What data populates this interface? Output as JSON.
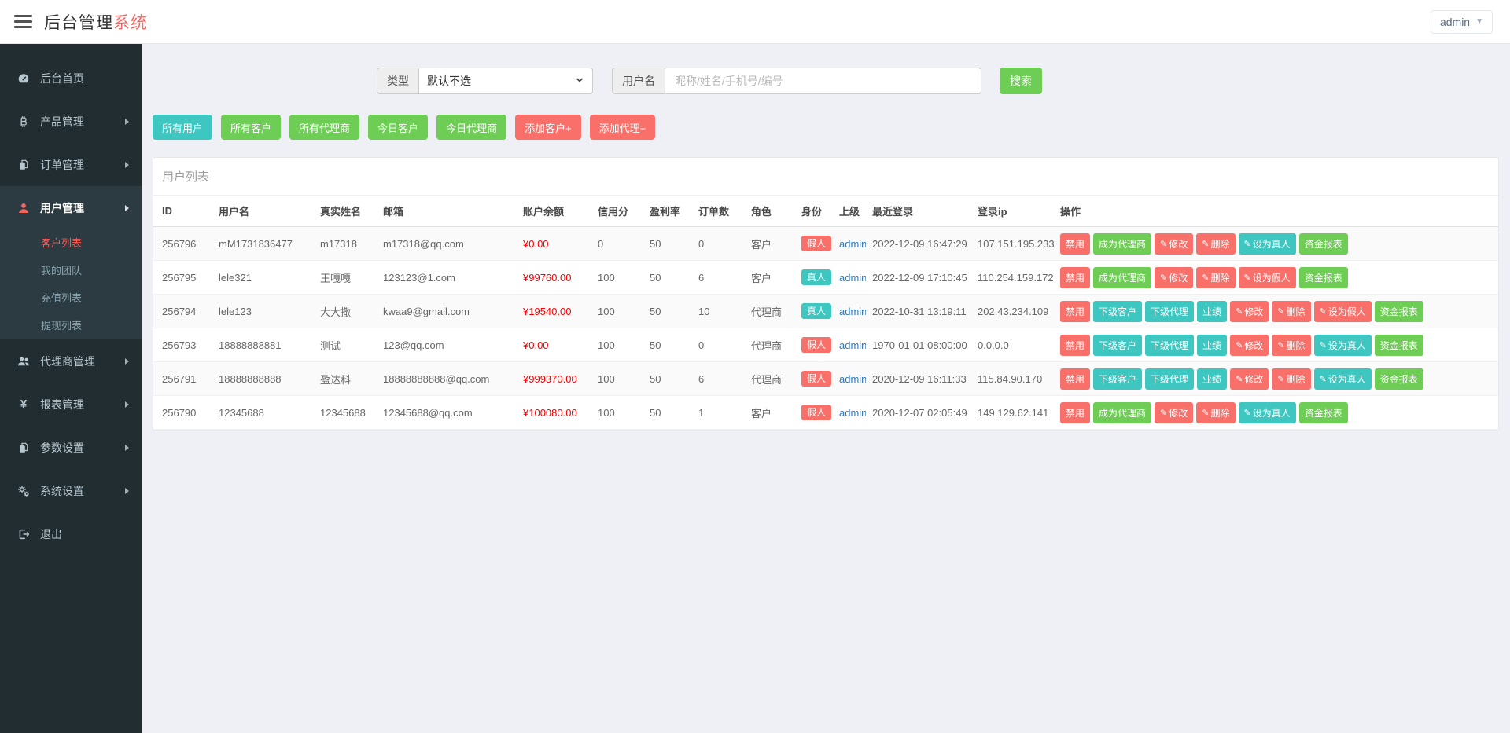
{
  "header": {
    "title_dark": "后台管理",
    "title_red": "系统",
    "user_menu": "admin"
  },
  "sidebar": {
    "items": [
      {
        "key": "home",
        "label": "后台首页",
        "icon": "dashboard-icon",
        "arrow": false,
        "active": false
      },
      {
        "key": "products",
        "label": "产品管理",
        "icon": "bitcoin-icon",
        "arrow": true,
        "active": false
      },
      {
        "key": "orders",
        "label": "订单管理",
        "icon": "orders-icon",
        "arrow": true,
        "active": false
      },
      {
        "key": "users",
        "label": "用户管理",
        "icon": "user-icon",
        "arrow": true,
        "active": true,
        "submenu": [
          {
            "key": "customers",
            "label": "客户列表",
            "active": true
          },
          {
            "key": "team",
            "label": "我的团队",
            "active": false
          },
          {
            "key": "recharge",
            "label": "充值列表",
            "active": false
          },
          {
            "key": "withdraw",
            "label": "提现列表",
            "active": false
          }
        ]
      },
      {
        "key": "agents",
        "label": "代理商管理",
        "icon": "agents-icon",
        "arrow": true,
        "active": false
      },
      {
        "key": "reports",
        "label": "报表管理",
        "icon": "yen-icon",
        "arrow": true,
        "active": false
      },
      {
        "key": "params",
        "label": "参数设置",
        "icon": "params-icon",
        "arrow": true,
        "active": false
      },
      {
        "key": "system",
        "label": "系统设置",
        "icon": "gears-icon",
        "arrow": true,
        "active": false
      },
      {
        "key": "logout",
        "label": "退出",
        "icon": "logout-icon",
        "arrow": false,
        "active": false
      }
    ]
  },
  "filters": {
    "type_label": "类型",
    "type_value": "默认不选",
    "username_label": "用户名",
    "username_placeholder": "昵称/姓名/手机号/编号",
    "search_button": "搜索"
  },
  "toolbar": {
    "buttons": [
      {
        "label": "所有用户",
        "color": "teal"
      },
      {
        "label": "所有客户",
        "color": "green"
      },
      {
        "label": "所有代理商",
        "color": "green"
      },
      {
        "label": "今日客户",
        "color": "green"
      },
      {
        "label": "今日代理商",
        "color": "green"
      },
      {
        "label": "添加客户+",
        "color": "red"
      },
      {
        "label": "添加代理+",
        "color": "red"
      }
    ]
  },
  "table": {
    "title": "用户列表",
    "columns": [
      "ID",
      "用户名",
      "真实姓名",
      "邮箱",
      "账户余额",
      "信用分",
      "盈利率",
      "订单数",
      "角色",
      "身份",
      "上级",
      "最近登录",
      "登录ip",
      "操作"
    ],
    "rows": [
      {
        "id": "256796",
        "username": "mM1731836477",
        "realname": "m17318",
        "email": "m17318@qq.com",
        "balance": "¥0.00",
        "credit": "0",
        "profit_rate": "50",
        "order_count": "0",
        "role": "客户",
        "identity": "假人",
        "identity_color": "red",
        "parent": "admin",
        "last_login": "2022-12-09 16:47:29",
        "login_ip": "107.151.195.233",
        "actions": [
          {
            "label": "禁用",
            "color": "red",
            "pencil": false
          },
          {
            "label": "成为代理商",
            "color": "green",
            "pencil": false
          },
          {
            "label": "修改",
            "color": "red",
            "pencil": true
          },
          {
            "label": "删除",
            "color": "red",
            "pencil": true
          },
          {
            "label": "设为真人",
            "color": "teal",
            "pencil": true
          },
          {
            "label": "资金报表",
            "color": "green",
            "pencil": false
          }
        ]
      },
      {
        "id": "256795",
        "username": "lele321",
        "realname": "王嘎嘎",
        "email": "123123@1.com",
        "balance": "¥99760.00",
        "credit": "100",
        "profit_rate": "50",
        "order_count": "6",
        "role": "客户",
        "identity": "真人",
        "identity_color": "teal",
        "parent": "admin",
        "last_login": "2022-12-09 17:10:45",
        "login_ip": "110.254.159.172",
        "actions": [
          {
            "label": "禁用",
            "color": "red",
            "pencil": false
          },
          {
            "label": "成为代理商",
            "color": "green",
            "pencil": false
          },
          {
            "label": "修改",
            "color": "red",
            "pencil": true
          },
          {
            "label": "删除",
            "color": "red",
            "pencil": true
          },
          {
            "label": "设为假人",
            "color": "red",
            "pencil": true
          },
          {
            "label": "资金报表",
            "color": "green",
            "pencil": false
          }
        ]
      },
      {
        "id": "256794",
        "username": "lele123",
        "realname": "大大撒",
        "email": "kwaa9@gmail.com",
        "balance": "¥19540.00",
        "credit": "100",
        "profit_rate": "50",
        "order_count": "10",
        "role": "代理商",
        "identity": "真人",
        "identity_color": "teal",
        "parent": "admin",
        "last_login": "2022-10-31 13:19:11",
        "login_ip": "202.43.234.109",
        "actions": [
          {
            "label": "禁用",
            "color": "red",
            "pencil": false
          },
          {
            "label": "下级客户",
            "color": "teal",
            "pencil": false
          },
          {
            "label": "下级代理",
            "color": "teal",
            "pencil": false
          },
          {
            "label": "业绩",
            "color": "teal",
            "pencil": false
          },
          {
            "label": "修改",
            "color": "red",
            "pencil": true
          },
          {
            "label": "删除",
            "color": "red",
            "pencil": true
          },
          {
            "label": "设为假人",
            "color": "red",
            "pencil": true
          },
          {
            "label": "资金报表",
            "color": "green",
            "pencil": false
          }
        ]
      },
      {
        "id": "256793",
        "username": "18888888881",
        "realname": "测试",
        "email": "123@qq.com",
        "balance": "¥0.00",
        "credit": "100",
        "profit_rate": "50",
        "order_count": "0",
        "role": "代理商",
        "identity": "假人",
        "identity_color": "red",
        "parent": "admin",
        "last_login": "1970-01-01 08:00:00",
        "login_ip": "0.0.0.0",
        "actions": [
          {
            "label": "禁用",
            "color": "red",
            "pencil": false
          },
          {
            "label": "下级客户",
            "color": "teal",
            "pencil": false
          },
          {
            "label": "下级代理",
            "color": "teal",
            "pencil": false
          },
          {
            "label": "业绩",
            "color": "teal",
            "pencil": false
          },
          {
            "label": "修改",
            "color": "red",
            "pencil": true
          },
          {
            "label": "删除",
            "color": "red",
            "pencil": true
          },
          {
            "label": "设为真人",
            "color": "teal",
            "pencil": true
          },
          {
            "label": "资金报表",
            "color": "green",
            "pencil": false
          }
        ]
      },
      {
        "id": "256791",
        "username": "18888888888",
        "realname": "盈达科",
        "email": "18888888888@qq.com",
        "balance": "¥999370.00",
        "credit": "100",
        "profit_rate": "50",
        "order_count": "6",
        "role": "代理商",
        "identity": "假人",
        "identity_color": "red",
        "parent": "admin",
        "last_login": "2020-12-09 16:11:33",
        "login_ip": "115.84.90.170",
        "actions": [
          {
            "label": "禁用",
            "color": "red",
            "pencil": false
          },
          {
            "label": "下级客户",
            "color": "teal",
            "pencil": false
          },
          {
            "label": "下级代理",
            "color": "teal",
            "pencil": false
          },
          {
            "label": "业绩",
            "color": "teal",
            "pencil": false
          },
          {
            "label": "修改",
            "color": "red",
            "pencil": true
          },
          {
            "label": "删除",
            "color": "red",
            "pencil": true
          },
          {
            "label": "设为真人",
            "color": "teal",
            "pencil": true
          },
          {
            "label": "资金报表",
            "color": "green",
            "pencil": false
          }
        ]
      },
      {
        "id": "256790",
        "username": "12345688",
        "realname": "12345688",
        "email": "12345688@qq.com",
        "balance": "¥100080.00",
        "credit": "100",
        "profit_rate": "50",
        "order_count": "1",
        "role": "客户",
        "identity": "假人",
        "identity_color": "red",
        "parent": "admin",
        "last_login": "2020-12-07 02:05:49",
        "login_ip": "149.129.62.141",
        "actions": [
          {
            "label": "禁用",
            "color": "red",
            "pencil": false
          },
          {
            "label": "成为代理商",
            "color": "green",
            "pencil": false
          },
          {
            "label": "修改",
            "color": "red",
            "pencil": true
          },
          {
            "label": "删除",
            "color": "red",
            "pencil": true
          },
          {
            "label": "设为真人",
            "color": "teal",
            "pencil": true
          },
          {
            "label": "资金报表",
            "color": "green",
            "pencil": false
          }
        ]
      }
    ]
  },
  "colors": {
    "accent_red": "#f4655f",
    "teal": "#3ec6c0",
    "green": "#6ecd54",
    "red": "#f9706a",
    "balance_red": "#f50000",
    "link_blue": "#337ab7",
    "sidebar_bg": "#222d32",
    "sidebar_active_bg": "#2c3b41",
    "content_bg": "#eef0f5"
  }
}
